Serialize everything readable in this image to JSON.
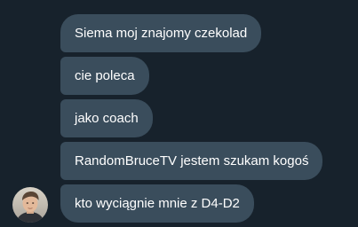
{
  "conversation": {
    "messages": [
      {
        "text": "Siema moj znajomy czekolad"
      },
      {
        "text": "cie poleca"
      },
      {
        "text": "jako coach"
      },
      {
        "text": "RandomBruceTV jestem szukam kogoś"
      },
      {
        "text": "kto wyciągnie mnie z D4-D2"
      }
    ],
    "avatar_icon": "user-avatar-photo"
  },
  "colors": {
    "background": "#17222c",
    "bubble": "#3a4d5c",
    "text": "#ffffff"
  }
}
